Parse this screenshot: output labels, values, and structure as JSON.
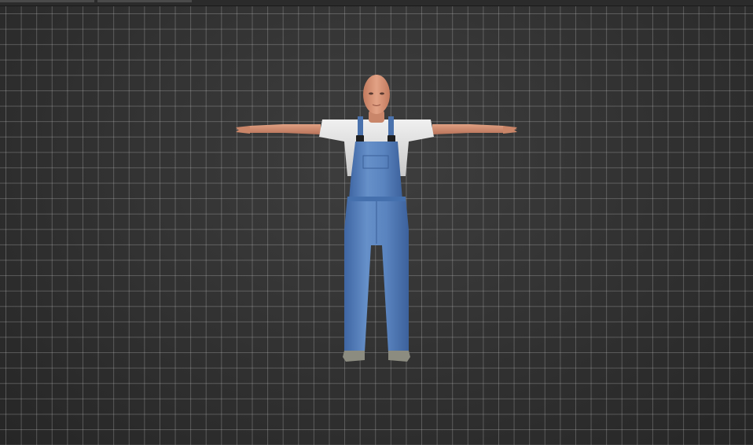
{
  "viewport": {
    "view": "3d-viewport",
    "grid": true,
    "colors": {
      "background": "#333333",
      "grid_line": "#8a8a8a",
      "skin": "#d9967a",
      "shirt": "#e6e6e6",
      "overalls": "#5a84bf",
      "boots": "#8c8c80"
    }
  },
  "model": {
    "pose": "t-pose",
    "icon": "character-model"
  }
}
